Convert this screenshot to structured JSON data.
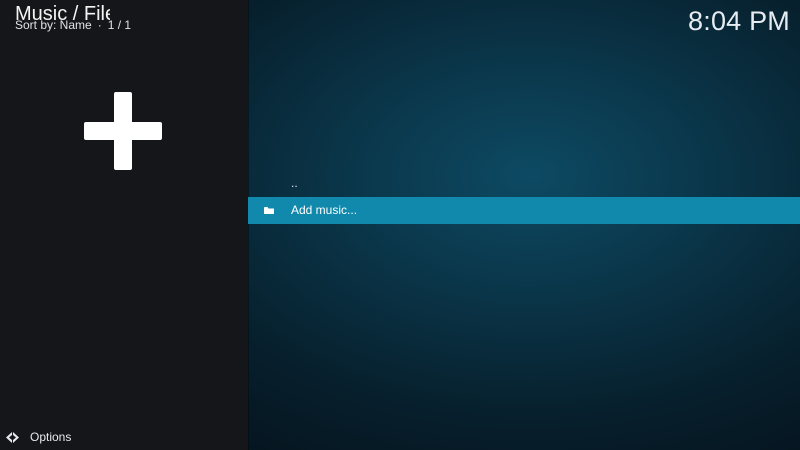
{
  "header": {
    "title": "Music / Files",
    "sort_label": "Sort by: Name",
    "separator": "·",
    "page_count": "1 / 1",
    "clock": "8:04 PM"
  },
  "sidebar": {
    "icon": "add-plus-icon"
  },
  "list": {
    "items": [
      {
        "label": "..",
        "icon": "",
        "selected": false
      },
      {
        "label": "Add music...",
        "icon": "folder-icon",
        "selected": true
      }
    ]
  },
  "footer": {
    "options_label": "Options",
    "options_icon": "options-arrows-icon"
  },
  "colors": {
    "selection": "#1089ad",
    "panel": "#151619",
    "background": "#0a3346"
  }
}
